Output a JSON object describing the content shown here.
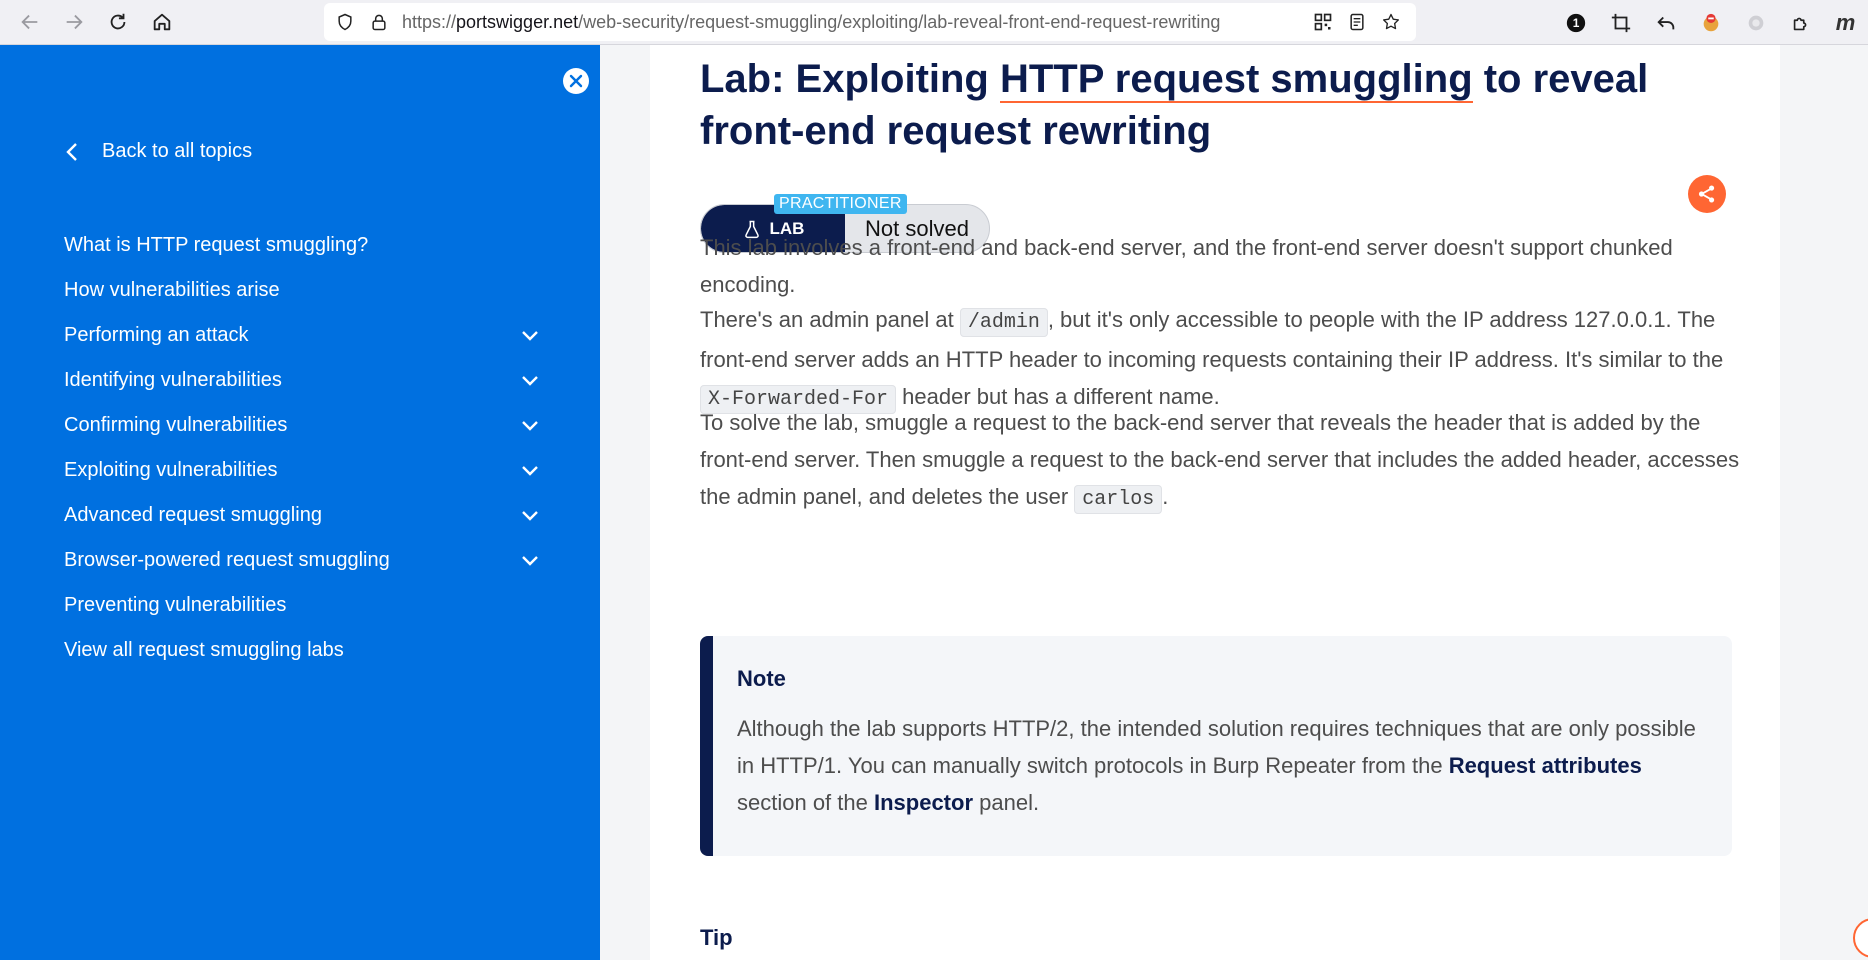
{
  "browser": {
    "url_domain": "portswigger.net",
    "url_prefix": "https://",
    "url_path": "/web-security/request-smuggling/exploiting/lab-reveal-front-end-request-rewriting",
    "notification_count": "1",
    "profile_initial": "m"
  },
  "sidebar": {
    "back_label": "Back to all topics",
    "items": [
      {
        "label": "What is HTTP request smuggling?",
        "expandable": false
      },
      {
        "label": "How vulnerabilities arise",
        "expandable": false
      },
      {
        "label": "Performing an attack",
        "expandable": true
      },
      {
        "label": "Identifying vulnerabilities",
        "expandable": true
      },
      {
        "label": "Confirming vulnerabilities",
        "expandable": true
      },
      {
        "label": "Exploiting vulnerabilities",
        "expandable": true
      },
      {
        "label": "Advanced request smuggling",
        "expandable": true
      },
      {
        "label": "Browser-powered request smuggling",
        "expandable": true
      },
      {
        "label": "Preventing vulnerabilities",
        "expandable": false
      },
      {
        "label": "View all request smuggling labs",
        "expandable": false
      }
    ]
  },
  "main": {
    "title_part1": "Lab: Exploiting ",
    "title_underlined": "HTTP request smuggling",
    "title_part2": " to reveal front-end request rewriting",
    "level_badge": "PRACTITIONER",
    "lab_label": "LAB",
    "status": "Not solved",
    "p1": "This lab involves a front-end and back-end server, and the front-end server doesn't support chunked encoding.",
    "p2_a": "There's an admin panel at ",
    "p2_code1": "/admin",
    "p2_b": ", but it's only accessible to people with the IP address 127.0.0.1. The front-end server adds an HTTP header to incoming requests containing their IP address. It's similar to the ",
    "p2_code2": "X-Forwarded-For",
    "p2_c": " header but has a different name.",
    "p3_a": "To solve the lab, smuggle a request to the back-end server that reveals the header that is added by the front-end server. Then smuggle a request to the back-end server that includes the added header, accesses the admin panel, and deletes the user ",
    "p3_code": "carlos",
    "p3_b": ".",
    "note_title": "Note",
    "note_a": "Although the lab supports HTTP/2, the intended solution requires techniques that are only possible in HTTP/1. You can manually switch protocols in Burp Repeater from the ",
    "note_strong1": "Request attributes",
    "note_b": " section of the ",
    "note_strong2": "Inspector",
    "note_c": " panel.",
    "tip_title": "Tip"
  },
  "colors": {
    "sidebar_bg": "#0070e0",
    "navy": "#0c1c4d",
    "accent_orange": "#ff6633",
    "practitioner_blue": "#3fb6f0"
  }
}
